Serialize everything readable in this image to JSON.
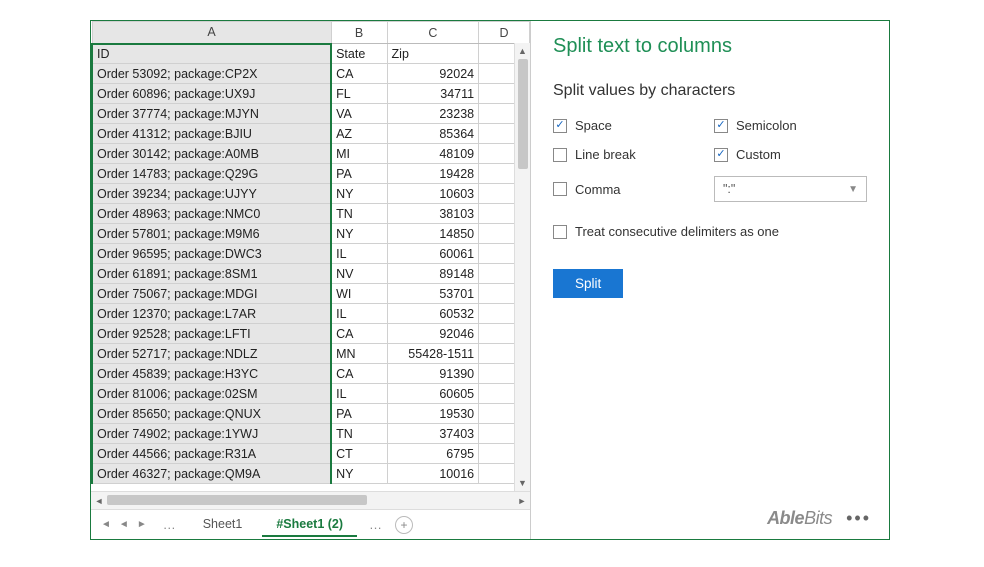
{
  "columns": [
    "A",
    "B",
    "C",
    "D"
  ],
  "headers": {
    "A": "ID",
    "B": "State",
    "C": "Zip",
    "D": ""
  },
  "rows": [
    {
      "id": "Order 53092; package:CP2X",
      "state": "CA",
      "zip": "92024"
    },
    {
      "id": "Order 60896; package:UX9J",
      "state": "FL",
      "zip": "34711"
    },
    {
      "id": "Order 37774; package:MJYN",
      "state": "VA",
      "zip": "23238"
    },
    {
      "id": "Order 41312; package:BJIU",
      "state": "AZ",
      "zip": "85364"
    },
    {
      "id": "Order 30142; package:A0MB",
      "state": "MI",
      "zip": "48109"
    },
    {
      "id": "Order 14783; package:Q29G",
      "state": "PA",
      "zip": "19428"
    },
    {
      "id": "Order 39234; package:UJYY",
      "state": "NY",
      "zip": "10603"
    },
    {
      "id": "Order 48963; package:NMC0",
      "state": "TN",
      "zip": "38103"
    },
    {
      "id": "Order 57801; package:M9M6",
      "state": "NY",
      "zip": "14850"
    },
    {
      "id": "Order 96595; package:DWC3",
      "state": "IL",
      "zip": "60061"
    },
    {
      "id": "Order 61891; package:8SM1",
      "state": "NV",
      "zip": "89148"
    },
    {
      "id": "Order 75067; package:MDGI",
      "state": "WI",
      "zip": "53701"
    },
    {
      "id": "Order 12370; package:L7AR",
      "state": "IL",
      "zip": "60532"
    },
    {
      "id": "Order 92528; package:LFTI",
      "state": "CA",
      "zip": "92046"
    },
    {
      "id": "Order 52717; package:NDLZ",
      "state": "MN",
      "zip": "55428-1511"
    },
    {
      "id": "Order 45839; package:H3YC",
      "state": "CA",
      "zip": "91390"
    },
    {
      "id": "Order 81006; package:02SM",
      "state": "IL",
      "zip": "60605"
    },
    {
      "id": "Order 85650; package:QNUX",
      "state": "PA",
      "zip": "19530"
    },
    {
      "id": "Order 74902; package:1YWJ",
      "state": "TN",
      "zip": "37403"
    },
    {
      "id": "Order 44566; package:R31A",
      "state": "CT",
      "zip": "6795"
    },
    {
      "id": "Order 46327; package:QM9A",
      "state": "NY",
      "zip": "10016"
    }
  ],
  "tabs": {
    "sheet1": "Sheet1",
    "sheet2": "#Sheet1 (2)"
  },
  "panel": {
    "title": "Split text to columns",
    "section": "Split values by characters",
    "options": {
      "space": {
        "label": "Space",
        "checked": true
      },
      "semicolon": {
        "label": "Semicolon",
        "checked": true
      },
      "linebreak": {
        "label": "Line break",
        "checked": false
      },
      "custom": {
        "label": "Custom",
        "checked": true
      },
      "comma": {
        "label": "Comma",
        "checked": false
      }
    },
    "custom_value": "\":\"",
    "treat_consecutive": {
      "label": "Treat consecutive delimiters as one",
      "checked": false
    },
    "split_btn": "Split",
    "brand": "AbleBits"
  }
}
